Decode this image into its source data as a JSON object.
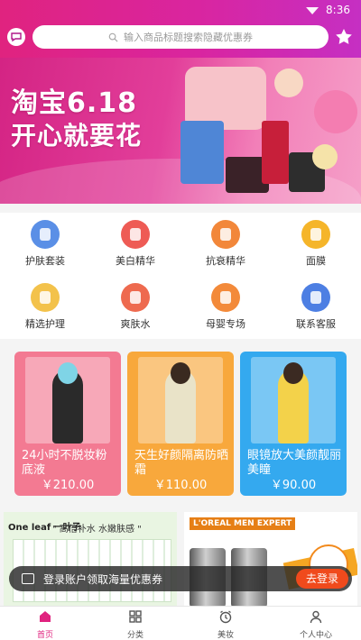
{
  "status_bar": {
    "time": "8:36",
    "icons": [
      "wifi-icon",
      "battery-icon"
    ]
  },
  "header": {
    "search_placeholder": "输入商品标题搜索隐藏优惠券",
    "left_icon": "message-icon",
    "right_icon": "star-icon",
    "colors": {
      "gradient_start": "#e0237f",
      "gradient_end": "#c52fc3"
    }
  },
  "banner": {
    "title": "淘宝6.18",
    "subtitle": "开心就要花"
  },
  "categories": [
    {
      "label": "护肤套装",
      "icon": "skincare-set-icon",
      "color": "#5a8fe6"
    },
    {
      "label": "美白精华",
      "icon": "whitening-serum-icon",
      "color": "#ee5b55"
    },
    {
      "label": "抗衰精华",
      "icon": "anti-aging-icon",
      "color": "#f2873a"
    },
    {
      "label": "面膜",
      "icon": "face-mask-icon",
      "color": "#f5b52a"
    },
    {
      "label": "精选护理",
      "icon": "care-icon",
      "color": "#f3c24b"
    },
    {
      "label": "爽肤水",
      "icon": "toner-icon",
      "color": "#ee6a4f"
    },
    {
      "label": "母婴专场",
      "icon": "baby-icon",
      "color": "#f38a3a"
    },
    {
      "label": "联系客服",
      "icon": "service-icon",
      "color": "#4d7fe3"
    }
  ],
  "products": [
    {
      "title": "24小时不脱妆粉底液",
      "price": "￥210.00",
      "color": "#f37a92",
      "figure": "#2a2a2a"
    },
    {
      "title": "天生好颜隔离防晒霜",
      "price": "￥110.00",
      "color": "#f8a83c",
      "figure": "#e9e3c8"
    },
    {
      "title": "眼镜放大美颜靓丽美瞳",
      "price": "￥90.00",
      "color": "#34a9ef",
      "figure": "#f3d24a"
    }
  ],
  "promos": {
    "left_brand": "One leaf 一叶子",
    "left_slogan": "\" 高倍补水 水嫩肤感 \"",
    "right_brand": "L'OREAL MEN EXPERT"
  },
  "login_bar": {
    "text": "登录账户领取海量优惠券",
    "button": "去登录"
  },
  "nav": [
    {
      "label": "首页",
      "icon": "home-icon",
      "active": true
    },
    {
      "label": "分类",
      "icon": "grid-icon",
      "active": false
    },
    {
      "label": "美妆",
      "icon": "alarm-icon",
      "active": false
    },
    {
      "label": "个人中心",
      "icon": "user-icon",
      "active": false
    }
  ]
}
